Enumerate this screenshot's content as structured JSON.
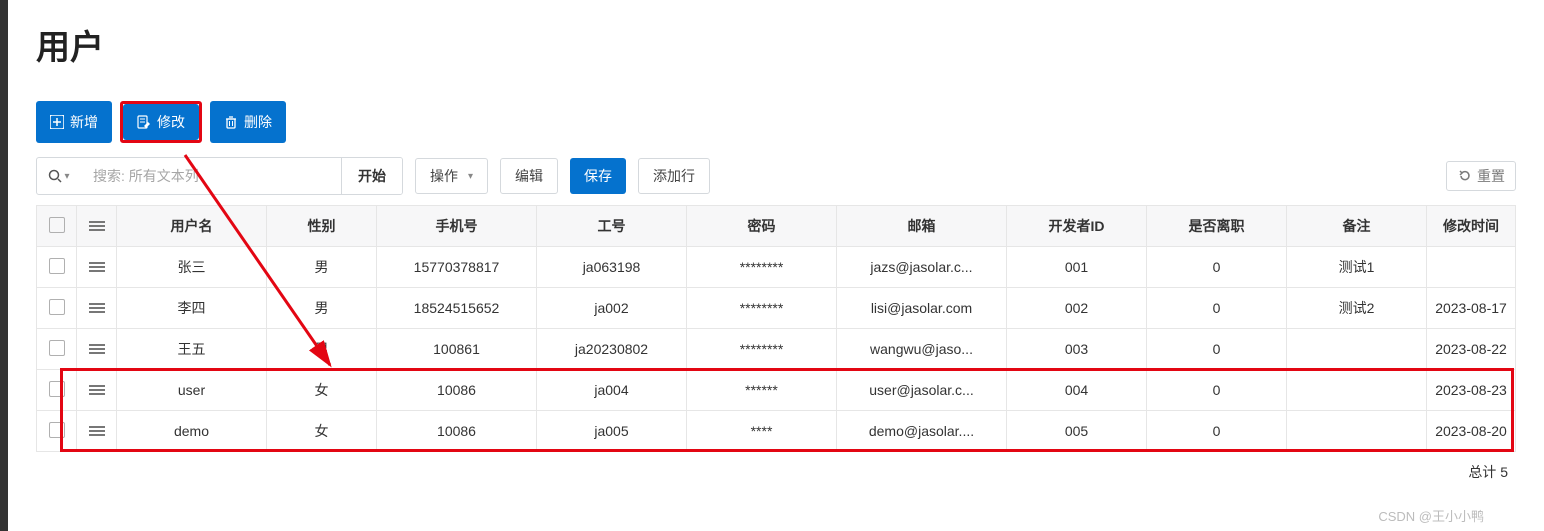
{
  "page": {
    "title": "用户"
  },
  "toolbar": {
    "add_label": "新增",
    "edit_label": "修改",
    "delete_label": "删除"
  },
  "search": {
    "placeholder": "搜索: 所有文本列",
    "start_label": "开始",
    "actions_label": "操作",
    "edit_label": "编辑",
    "save_label": "保存",
    "addrow_label": "添加行",
    "reset_label": "重置"
  },
  "table": {
    "headers": {
      "username": "用户名",
      "gender": "性别",
      "phone": "手机号",
      "empno": "工号",
      "password": "密码",
      "email": "邮箱",
      "devid": "开发者ID",
      "resigned": "是否离职",
      "remark": "备注",
      "modtime": "修改时间"
    },
    "rows": [
      {
        "username": "张三",
        "gender": "男",
        "phone": "15770378817",
        "empno": "ja063198",
        "password": "********",
        "email": "jazs@jasolar.c...",
        "devid": "001",
        "resigned": "0",
        "remark": "测试1",
        "modtime": ""
      },
      {
        "username": "李四",
        "gender": "男",
        "phone": "18524515652",
        "empno": "ja002",
        "password": "********",
        "email": "lisi@jasolar.com",
        "devid": "002",
        "resigned": "0",
        "remark": "测试2",
        "modtime": "2023-08-17"
      },
      {
        "username": "王五",
        "gender": "男",
        "phone": "100861",
        "empno": "ja20230802",
        "password": "********",
        "email": "wangwu@jaso...",
        "devid": "003",
        "resigned": "0",
        "remark": "",
        "modtime": "2023-08-22"
      },
      {
        "username": "user",
        "gender": "女",
        "phone": "10086",
        "empno": "ja004",
        "password": "******",
        "email": "user@jasolar.c...",
        "devid": "004",
        "resigned": "0",
        "remark": "",
        "modtime": "2023-08-23"
      },
      {
        "username": "demo",
        "gender": "女",
        "phone": "10086",
        "empno": "ja005",
        "password": "****",
        "email": "demo@jasolar....",
        "devid": "005",
        "resigned": "0",
        "remark": "",
        "modtime": "2023-08-20"
      }
    ],
    "total_label": "总计 5"
  },
  "watermark": "CSDN @王小小鸭"
}
